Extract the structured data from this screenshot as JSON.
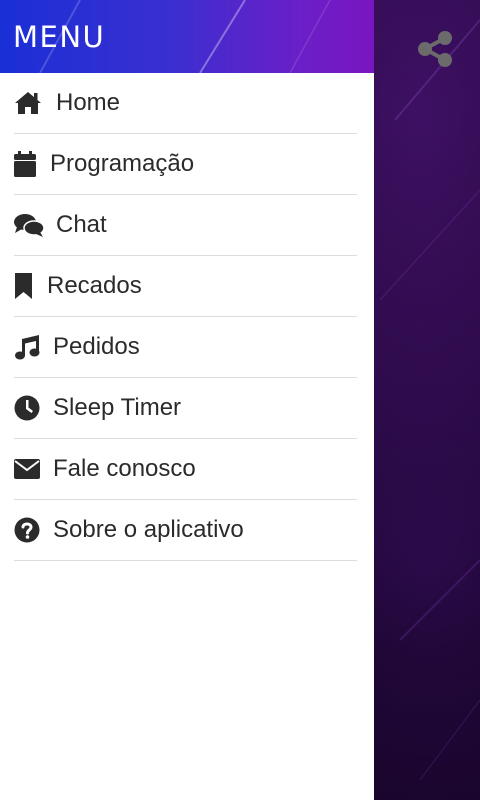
{
  "header": {
    "title": "MENU"
  },
  "menu": {
    "items": [
      {
        "label": "Home",
        "icon": "home-icon"
      },
      {
        "label": "Programação",
        "icon": "calendar-icon"
      },
      {
        "label": "Chat",
        "icon": "chat-bubbles-icon"
      },
      {
        "label": "Recados",
        "icon": "bookmark-icon"
      },
      {
        "label": "Pedidos",
        "icon": "music-note-icon"
      },
      {
        "label": "Sleep Timer",
        "icon": "clock-icon"
      },
      {
        "label": "Fale conosco",
        "icon": "envelope-icon"
      },
      {
        "label": "Sobre o aplicativo",
        "icon": "question-circle-icon"
      }
    ]
  },
  "share": {
    "icon": "share-icon"
  },
  "colors": {
    "header_gradient_start": "#1a2fd6",
    "header_gradient_end": "#7a16c0",
    "icon_color": "#2b2b2b",
    "background_dark": "#12001f"
  }
}
